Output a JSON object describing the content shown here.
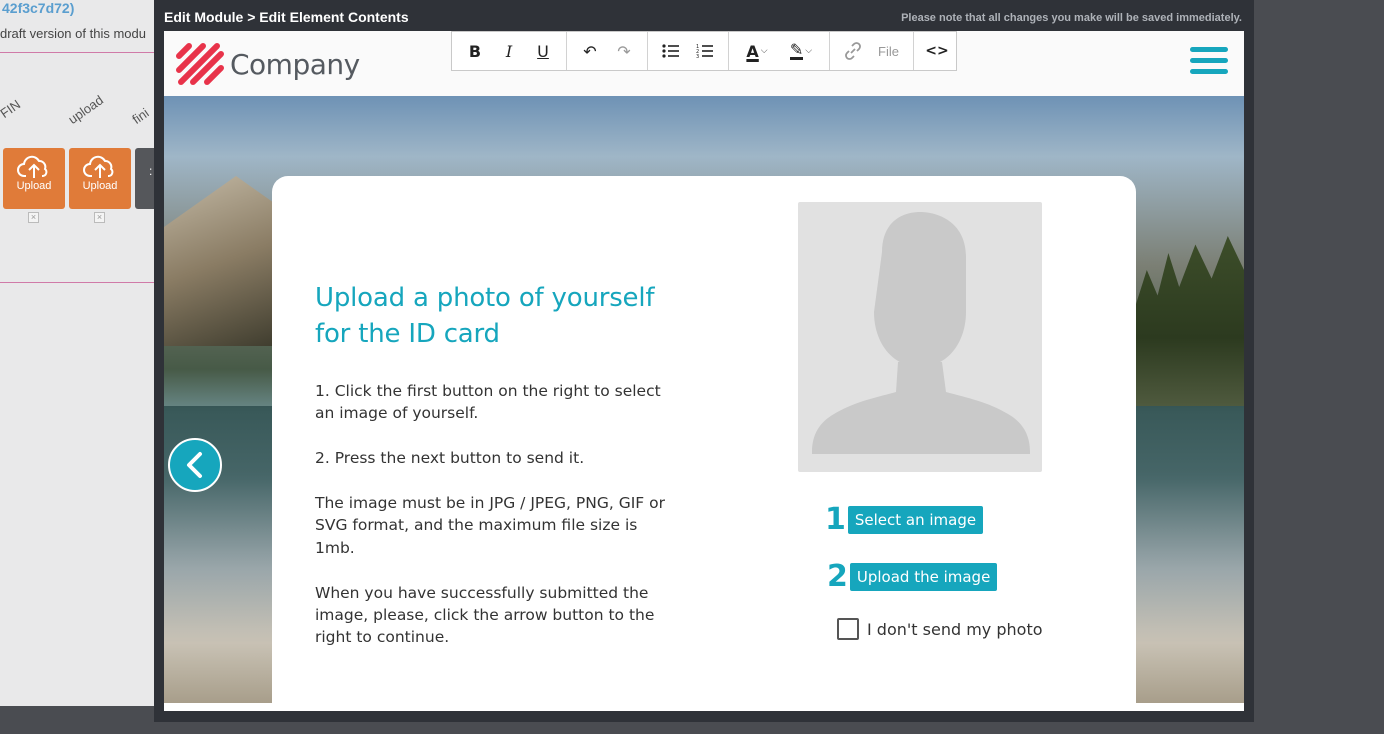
{
  "background_page": {
    "hash_text": "42f3c7d72)",
    "draft_text": "draft version of this modu",
    "column_labels": [
      "FIN",
      "upload",
      "fini"
    ],
    "upload_buttons": [
      {
        "label": "Upload"
      },
      {
        "label": "Upload"
      }
    ],
    "dark_button_glyph": ":"
  },
  "modal": {
    "title": "Edit Module > Edit Element Contents",
    "note": "Please note that all changes you make will be saved immediately."
  },
  "site": {
    "logo_text": "Company"
  },
  "toolbar": {
    "bold": "B",
    "italic": "I",
    "underline": "U",
    "undo": "↶",
    "redo": "↷",
    "bullet_list": "≔",
    "numbered_list": "⒈",
    "text_color": "A",
    "highlight": "✎",
    "link": "🔗",
    "file_label": "File",
    "source": "<>"
  },
  "card": {
    "title": "Upload a photo of yourself for the ID card",
    "paragraphs": [
      "1. Click the first button on the right to select an image of yourself.",
      "2. Press the next button to send it.",
      "The image must be in JPG / JPEG, PNG, GIF or SVG format, and the maximum file size is 1mb.",
      "When you have successfully submitted the image, please, click the arrow button to the right to continue."
    ],
    "step1_num": "1",
    "step1_label": "Select an image",
    "step2_num": "2",
    "step2_label": "Upload the image",
    "consent_label": "I don't send my photo",
    "consent_checked": false
  },
  "colors": {
    "accent": "#16a6bd",
    "upload_orange": "#e07b39",
    "logo_red": "#e8334a",
    "modal_dark": "#2f3238"
  }
}
